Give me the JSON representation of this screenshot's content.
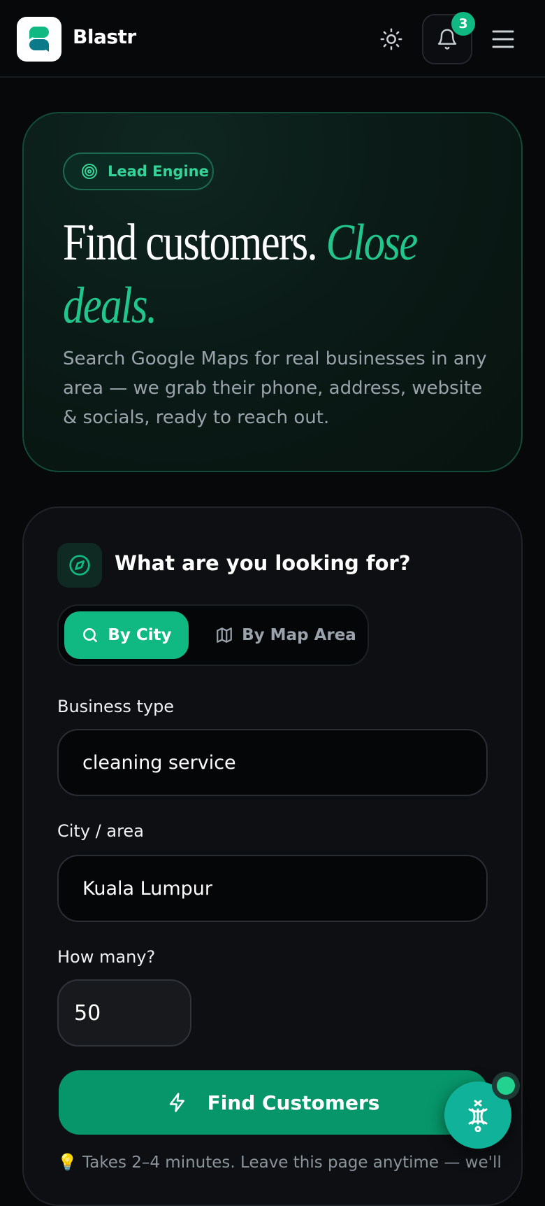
{
  "header": {
    "brand": "Blastr",
    "notification_count": "3"
  },
  "hero": {
    "pill_label": "Lead Engine",
    "title_plain": "Find customers. ",
    "title_accent": "Close deals.",
    "subtitle": "Search Google Maps for real businesses in any area — we grab their phone, address, website & socials, ready to reach out."
  },
  "search": {
    "title": "What are you looking for?",
    "tabs": [
      {
        "label": "By City",
        "active": true
      },
      {
        "label": "By Map Area",
        "active": false
      }
    ],
    "business_type_label": "Business type",
    "business_type_value": "cleaning service",
    "city_label": "City / area",
    "city_value": "Kuala Lumpur",
    "count_label": "How many?",
    "count_value": "50",
    "submit_label": "Find Customers",
    "hint_emoji": "💡",
    "hint_text": "Takes 2–4 minutes. Leave this page anytime — we'll"
  },
  "colors": {
    "accent": "#10b981",
    "accent_dark": "#079669",
    "background": "#07080a"
  },
  "icons": [
    "logo-icon",
    "sun-icon",
    "bell-icon",
    "menu-icon",
    "target-icon",
    "compass-icon",
    "search-icon",
    "map-icon",
    "bolt-icon",
    "fab-icon"
  ]
}
